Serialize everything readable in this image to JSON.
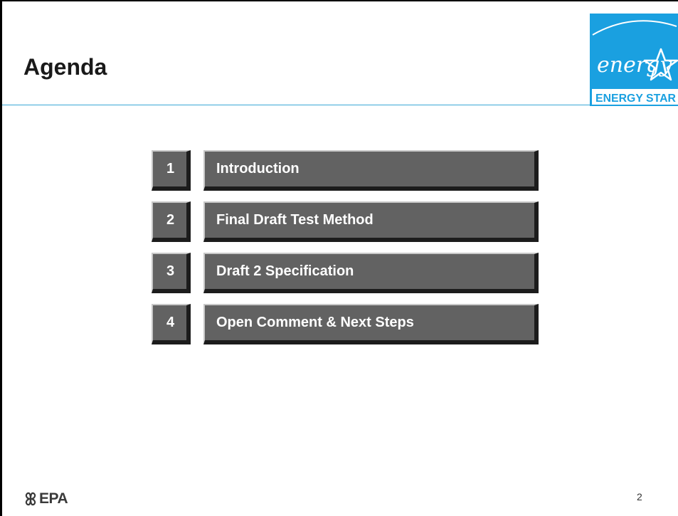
{
  "slide": {
    "title": "Agenda",
    "page_number": "2"
  },
  "logo": {
    "script_text": "energy",
    "label": "ENERGY STAR",
    "brand_color": "#1aa0e0"
  },
  "agenda": [
    {
      "number": "1",
      "label": "Introduction"
    },
    {
      "number": "2",
      "label": "Final Draft Test Method"
    },
    {
      "number": "3",
      "label": "Draft 2 Specification"
    },
    {
      "number": "4",
      "label": "Open Comment & Next Steps"
    }
  ],
  "footer": {
    "epa_label": "EPA",
    "epa_icon": "epa-flower-icon"
  },
  "colors": {
    "bar_fill": "#626262",
    "rule": "#3aa7d6"
  }
}
